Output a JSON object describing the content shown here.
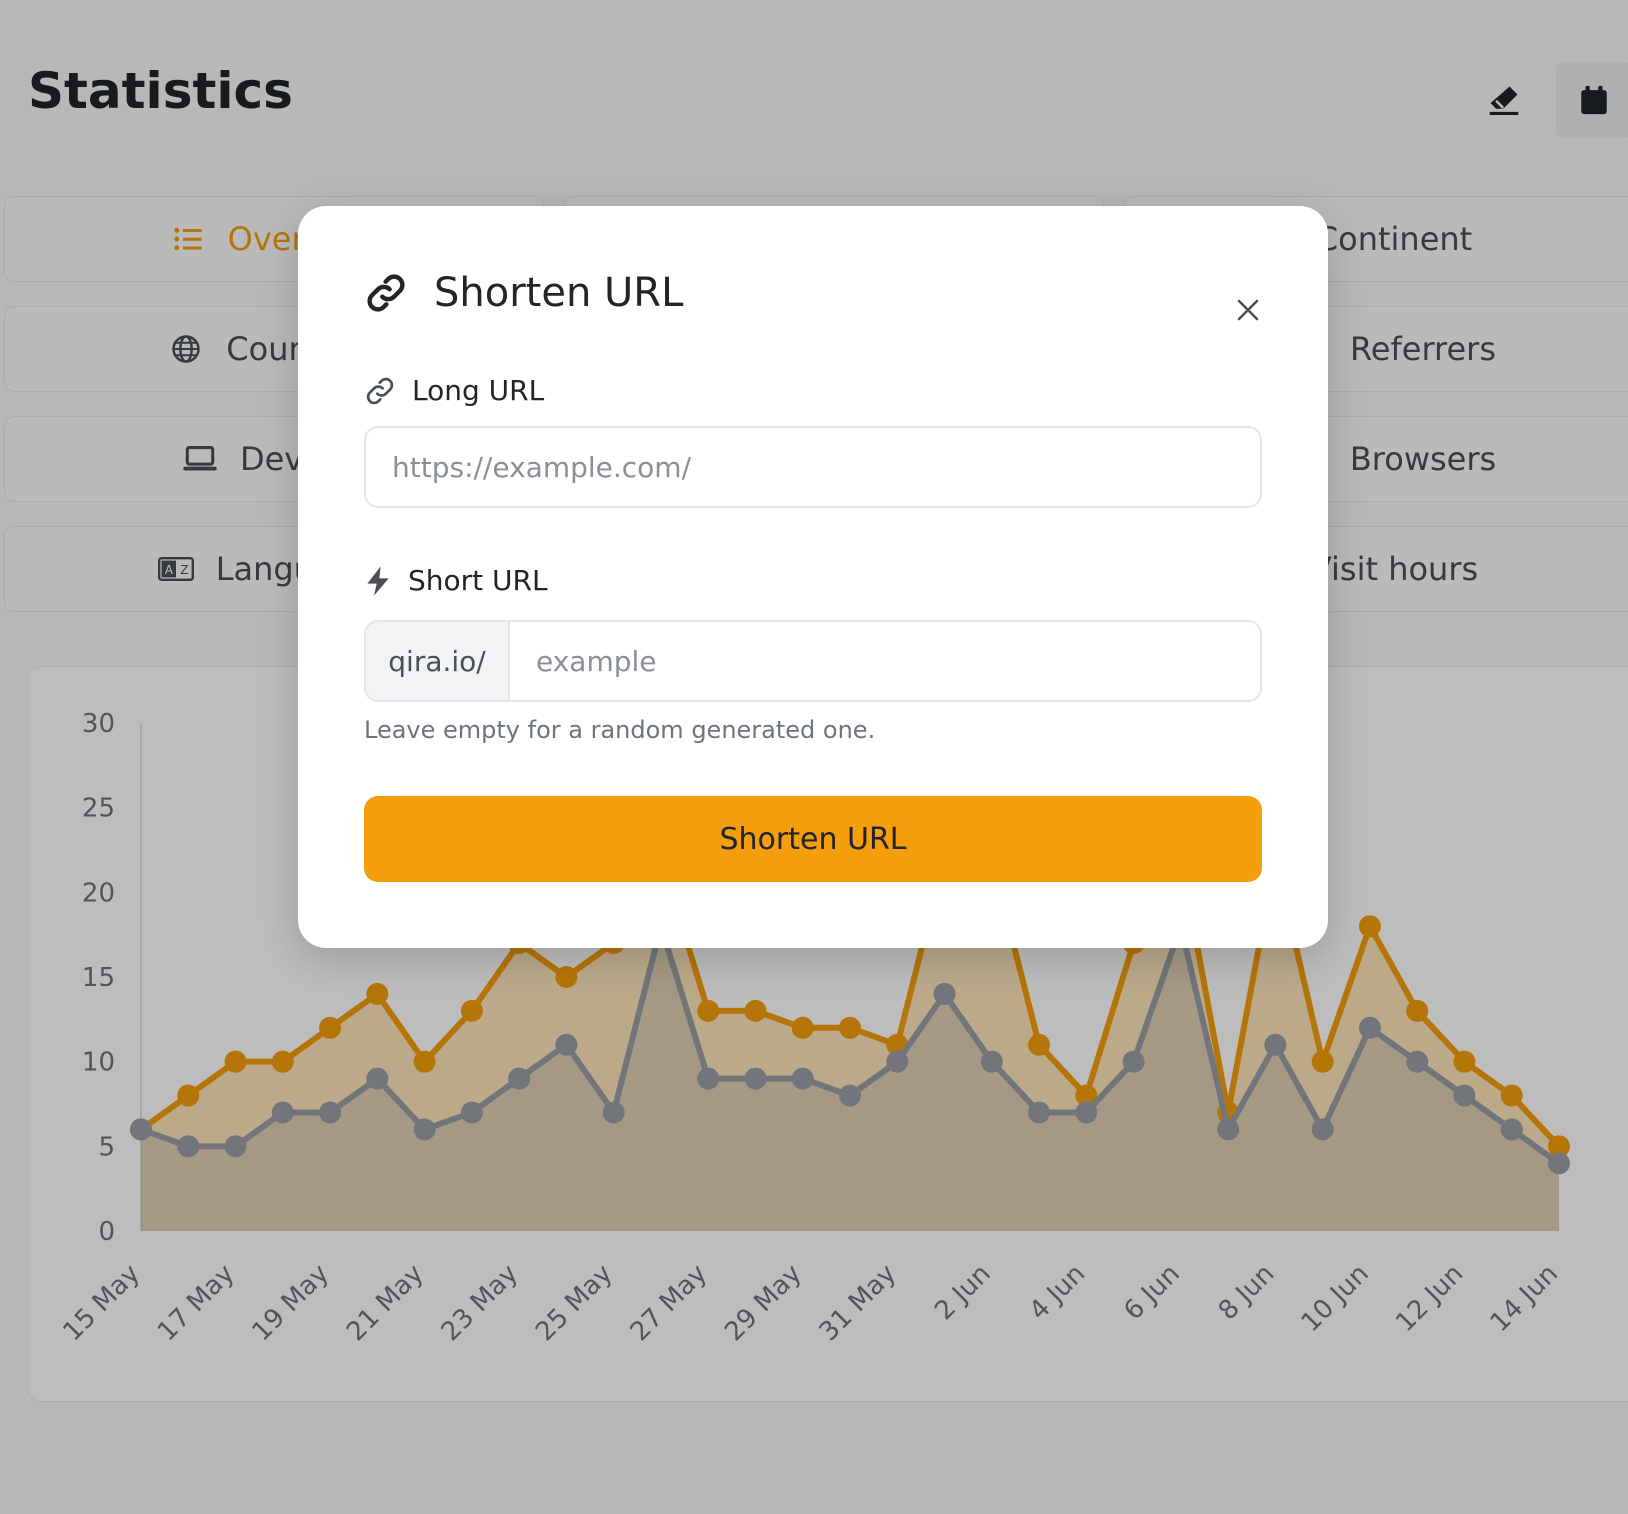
{
  "page": {
    "title": "Statistics",
    "actions": {
      "eraser_icon": "eraser-icon",
      "calendar_icon": "calendar-icon"
    }
  },
  "tabs": [
    {
      "label": "Overview",
      "icon": "list-icon",
      "active": true
    },
    {
      "label": "Continent",
      "icon": "globe-icon",
      "active": false
    },
    {
      "label": "Countries",
      "icon": "globe-icon",
      "active": false
    },
    {
      "label": "Referrers",
      "icon": "share-icon",
      "active": false
    },
    {
      "label": "Devices",
      "icon": "laptop-icon",
      "active": false
    },
    {
      "label": "Browsers",
      "icon": "browser-icon",
      "active": false
    },
    {
      "label": "Languages",
      "icon": "language-icon",
      "active": false
    },
    {
      "label": "Visit hours",
      "icon": "clock-icon",
      "active": false
    }
  ],
  "modal": {
    "title": "Shorten URL",
    "long_url": {
      "label": "Long URL",
      "placeholder": "https://example.com/",
      "value": ""
    },
    "short_url": {
      "label": "Short URL",
      "prefix": "qira.io/",
      "placeholder": "example",
      "value": "",
      "help": "Leave empty for a random generated one."
    },
    "submit_label": "Shorten URL"
  },
  "colors": {
    "accent": "#f59e0b",
    "secondary_series": "#9aa0a6",
    "backdrop": "rgba(0,0,0,0.26)"
  },
  "chart_data": {
    "type": "area",
    "x_tick_labels": [
      "15 May",
      "17 May",
      "19 May",
      "21 May",
      "23 May",
      "25 May",
      "27 May",
      "29 May",
      "31 May",
      "2 Jun",
      "4 Jun",
      "6 Jun",
      "8 Jun",
      "10 Jun",
      "12 Jun",
      "14 Jun"
    ],
    "x": [
      "15 May",
      "16 May",
      "17 May",
      "18 May",
      "19 May",
      "20 May",
      "21 May",
      "22 May",
      "23 May",
      "24 May",
      "25 May",
      "26 May",
      "27 May",
      "28 May",
      "29 May",
      "30 May",
      "31 May",
      "1 Jun",
      "2 Jun",
      "3 Jun",
      "4 Jun",
      "5 Jun",
      "6 Jun",
      "7 Jun",
      "8 Jun",
      "9 Jun",
      "10 Jun",
      "11 Jun",
      "12 Jun",
      "13 Jun",
      "14 Jun"
    ],
    "series": [
      {
        "color": "#f59e0b",
        "values": [
          6,
          8,
          10,
          10,
          12,
          14,
          10,
          13,
          17,
          15,
          17,
          22,
          13,
          13,
          12,
          12,
          11,
          22,
          22,
          11,
          8,
          17,
          22,
          7,
          22,
          10,
          18,
          13,
          10,
          8,
          5
        ]
      },
      {
        "color": "#9aa0a6",
        "values": [
          6,
          5,
          5,
          7,
          7,
          9,
          6,
          7,
          9,
          11,
          7,
          18,
          9,
          9,
          9,
          8,
          10,
          14,
          10,
          7,
          7,
          10,
          18,
          6,
          11,
          6,
          12,
          10,
          8,
          6,
          4
        ]
      }
    ],
    "y_ticks": [
      0,
      5,
      10,
      15,
      20,
      25,
      30
    ],
    "ylim": [
      0,
      30
    ],
    "grid": false,
    "legend": "none"
  }
}
